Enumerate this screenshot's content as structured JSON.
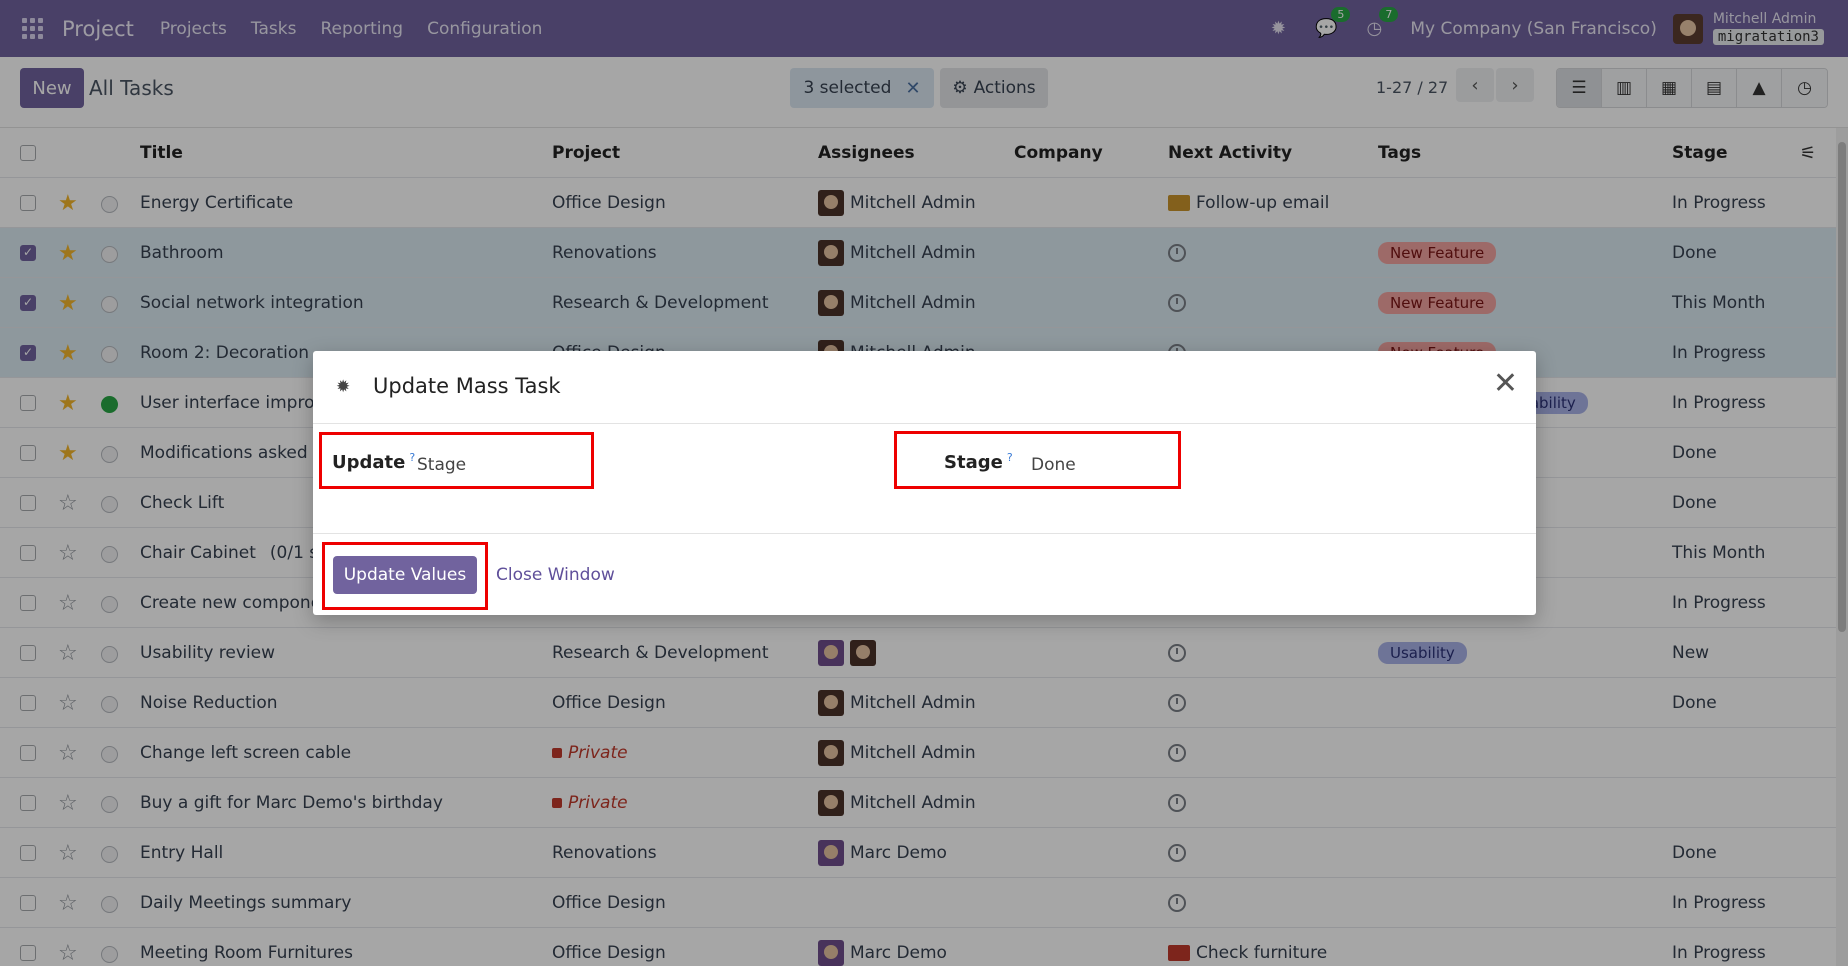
{
  "navbar": {
    "app_name": "Project",
    "menu": [
      "Projects",
      "Tasks",
      "Reporting",
      "Configuration"
    ],
    "messages_count": "5",
    "activities_count": "7",
    "company": "My Company (San Francisco)",
    "user": "Mitchell Admin",
    "database": "migratation3"
  },
  "control": {
    "new_label": "New",
    "breadcrumb": "All Tasks",
    "selected_label": "3 selected",
    "actions_label": "Actions",
    "pager": "1-27 / 27"
  },
  "table": {
    "headers": {
      "title": "Title",
      "project": "Project",
      "assignees": "Assignees",
      "company": "Company",
      "next_activity": "Next Activity",
      "tags": "Tags",
      "stage": "Stage"
    },
    "rows": [
      {
        "title": "Energy Certificate",
        "project": "Office Design",
        "assignee": "Mitchell Admin",
        "activity": "Follow-up email",
        "tag": "",
        "stage": "In Progress"
      },
      {
        "title": "Bathroom",
        "project": "Renovations",
        "assignee": "Mitchell Admin",
        "activity": "",
        "tag": "New Feature",
        "stage": "Done"
      },
      {
        "title": "Social network integration",
        "project": "Research & Development",
        "assignee": "Mitchell Admin",
        "activity": "",
        "tag": "New Feature",
        "stage": "This Month"
      },
      {
        "title": "Room 2: Decoration",
        "project": "Office Design",
        "assignee": "Mitchell Admin",
        "activity": "",
        "tag": "New Feature",
        "stage": "In Progress"
      },
      {
        "title": "User interface improv",
        "project": "",
        "assignee": "",
        "activity": "",
        "tag": "sability",
        "stage": "In Progress"
      },
      {
        "title": "Modifications asked b",
        "project": "",
        "assignee": "",
        "activity": "",
        "tag": "",
        "stage": "Done"
      },
      {
        "title": "Check Lift",
        "project": "",
        "assignee": "",
        "activity": "",
        "tag": "",
        "stage": "Done"
      },
      {
        "title": "Chair Cabinet",
        "title_extra": "(0/1 su",
        "project": "",
        "assignee": "",
        "activity": "",
        "tag": "",
        "stage": "This Month"
      },
      {
        "title": "Create new componen",
        "project": "",
        "assignee": "",
        "activity": "",
        "tag": "",
        "stage": "In Progress"
      },
      {
        "title": "Usability review",
        "project": "Research & Development",
        "assignee": "",
        "activity": "",
        "tag": "Usability",
        "stage": "New"
      },
      {
        "title": "Noise Reduction",
        "project": "Office Design",
        "assignee": "Mitchell Admin",
        "activity": "",
        "tag": "",
        "stage": "Done"
      },
      {
        "title": "Change left screen cable",
        "project": "Private",
        "assignee": "Mitchell Admin",
        "activity": "",
        "tag": "",
        "stage": ""
      },
      {
        "title": "Buy a gift for Marc Demo's birthday",
        "project": "Private",
        "assignee": "Mitchell Admin",
        "activity": "",
        "tag": "",
        "stage": ""
      },
      {
        "title": "Entry Hall",
        "project": "Renovations",
        "assignee": "Marc Demo",
        "activity": "",
        "tag": "",
        "stage": "Done"
      },
      {
        "title": "Daily Meetings summary",
        "project": "Office Design",
        "assignee": "",
        "activity": "",
        "tag": "",
        "stage": "In Progress"
      },
      {
        "title": "Meeting Room Furnitures",
        "project": "Office Design",
        "assignee": "Marc Demo",
        "activity": "Check furniture",
        "tag": "",
        "stage": "In Progress"
      }
    ]
  },
  "dialog": {
    "title": "Update Mass Task",
    "update_label": "Update",
    "update_value": "Stage",
    "stage_label": "Stage",
    "stage_value": "Done",
    "help_mark": "?",
    "update_button": "Update Values",
    "close_button": "Close Window"
  }
}
